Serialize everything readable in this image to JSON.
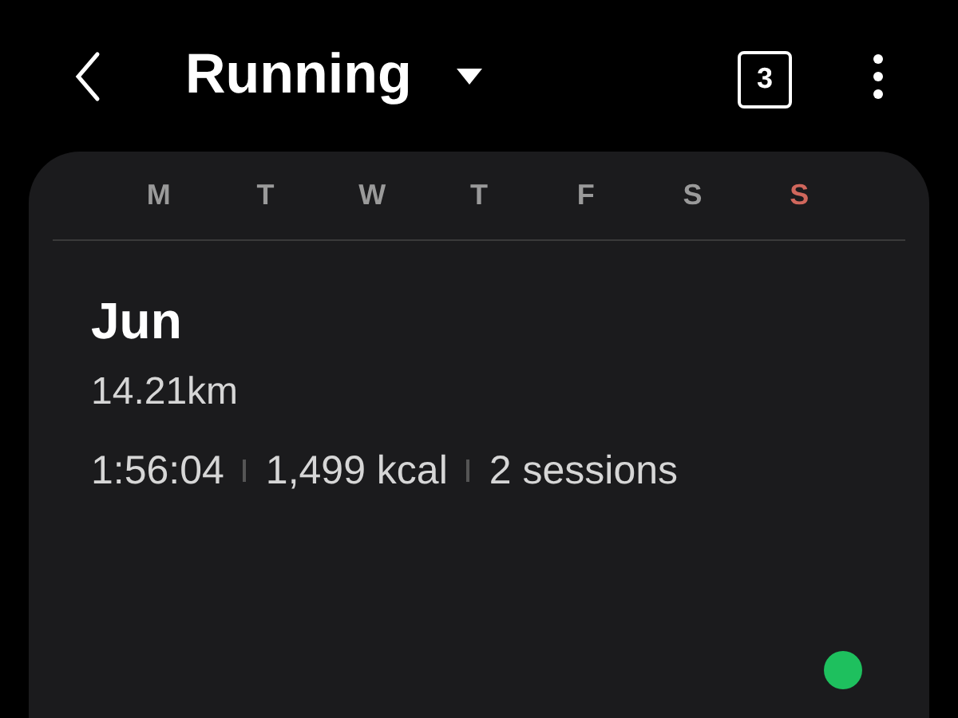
{
  "header": {
    "title": "Running",
    "calendar_day": "3"
  },
  "weekdays": [
    {
      "label": "M",
      "color": "#9a9a9a"
    },
    {
      "label": "T",
      "color": "#9a9a9a"
    },
    {
      "label": "W",
      "color": "#9a9a9a"
    },
    {
      "label": "T",
      "color": "#9a9a9a"
    },
    {
      "label": "F",
      "color": "#9a9a9a"
    },
    {
      "label": "S",
      "color": "#9a9a9a"
    },
    {
      "label": "S",
      "color": "#d0675c"
    }
  ],
  "summary": {
    "month": "Jun",
    "distance": "14.21km",
    "stats": [
      "1:56:04",
      "1,499 kcal",
      "2 sessions"
    ]
  }
}
